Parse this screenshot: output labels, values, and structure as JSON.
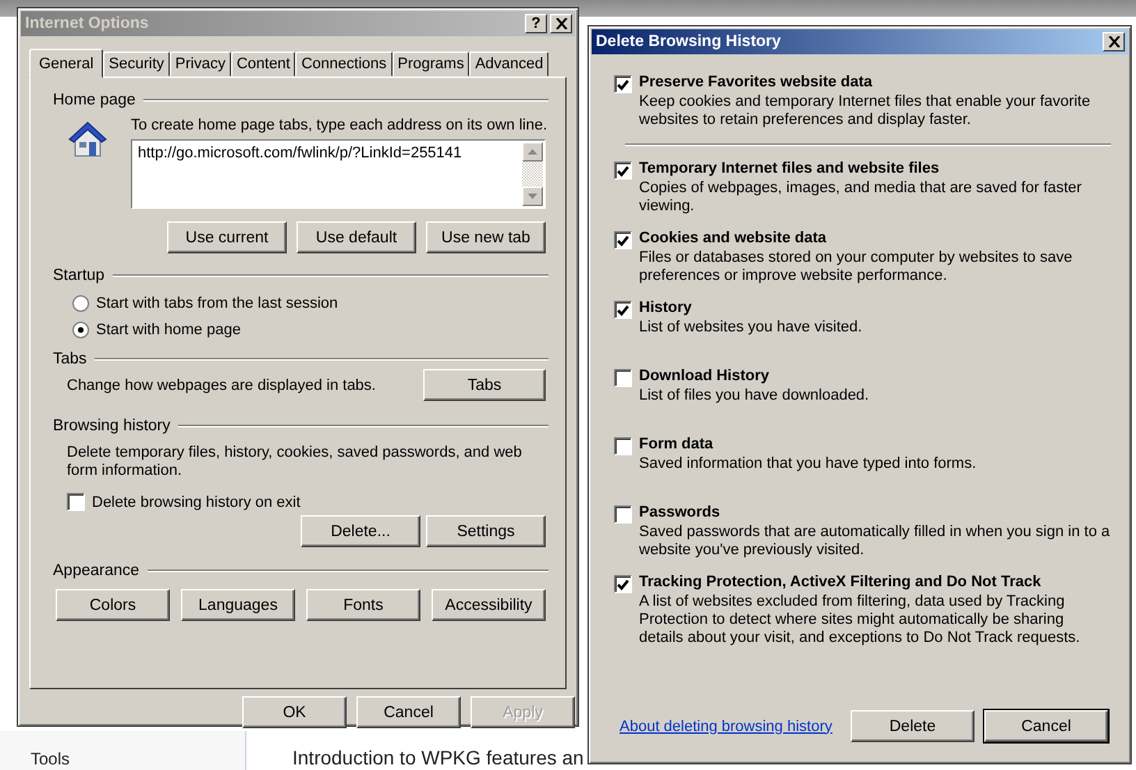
{
  "background_page": {
    "sidebar_item": "Tools",
    "heading": "Introduction to WPKG features an"
  },
  "internet_options": {
    "title": "Internet Options",
    "help_button": "?",
    "tabs": [
      {
        "label": "General",
        "selected": true
      },
      {
        "label": "Security",
        "selected": false
      },
      {
        "label": "Privacy",
        "selected": false
      },
      {
        "label": "Content",
        "selected": false
      },
      {
        "label": "Connections",
        "selected": false
      },
      {
        "label": "Programs",
        "selected": false
      },
      {
        "label": "Advanced",
        "selected": false
      }
    ],
    "home_page": {
      "legend": "Home page",
      "instruction": "To create home page tabs, type each address on its own line.",
      "address": "http://go.microsoft.com/fwlink/p/?LinkId=255141",
      "buttons": [
        "Use current",
        "Use default",
        "Use new tab"
      ]
    },
    "startup": {
      "legend": "Startup",
      "options": [
        {
          "label": "Start with tabs from the last session",
          "selected": false
        },
        {
          "label": "Start with home page",
          "selected": true
        }
      ]
    },
    "tabs_section": {
      "legend": "Tabs",
      "description": "Change how webpages are displayed in tabs.",
      "button": "Tabs"
    },
    "browsing_history": {
      "legend": "Browsing history",
      "description": "Delete temporary files, history, cookies, saved passwords, and web form information.",
      "checkbox": {
        "label": "Delete browsing history on exit",
        "checked": false
      },
      "buttons": [
        "Delete...",
        "Settings"
      ]
    },
    "appearance": {
      "legend": "Appearance",
      "buttons": [
        "Colors",
        "Languages",
        "Fonts",
        "Accessibility"
      ]
    },
    "footer_buttons": [
      {
        "label": "OK",
        "disabled": false
      },
      {
        "label": "Cancel",
        "disabled": false
      },
      {
        "label": "Apply",
        "disabled": true
      }
    ]
  },
  "delete_browsing_history": {
    "title": "Delete Browsing History",
    "preserve_item": {
      "title": "Preserve Favorites website data",
      "description": "Keep cookies and temporary Internet files that enable your favorite websites to retain preferences and display faster.",
      "checked": true
    },
    "items": [
      {
        "title": "Temporary Internet files and website files",
        "description": "Copies of webpages, images, and media that are saved for faster viewing.",
        "checked": true
      },
      {
        "title": "Cookies and website data",
        "description": "Files or databases stored on your computer by websites to save preferences or improve website performance.",
        "checked": true
      },
      {
        "title": "History",
        "description": "List of websites you have visited.",
        "checked": true
      },
      {
        "title": "Download History",
        "description": "List of files you have downloaded.",
        "checked": false
      },
      {
        "title": "Form data",
        "description": "Saved information that you have typed into forms.",
        "checked": false
      },
      {
        "title": "Passwords",
        "description": "Saved passwords that are automatically filled in when you sign in to a website you've previously visited.",
        "checked": false
      },
      {
        "title": "Tracking Protection, ActiveX Filtering and Do Not Track",
        "description": "A list of websites excluded from filtering, data used by Tracking Protection to detect where sites might automatically be sharing details about your visit, and exceptions to Do Not Track requests.",
        "checked": true
      }
    ],
    "link": "About deleting browsing history",
    "buttons": [
      {
        "label": "Delete",
        "default": false
      },
      {
        "label": "Cancel",
        "default": true
      }
    ]
  }
}
